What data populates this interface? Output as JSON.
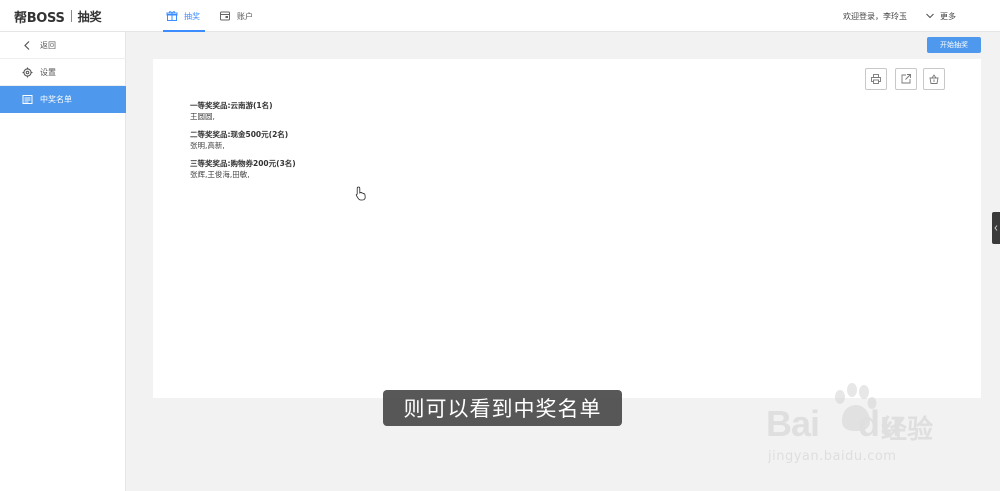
{
  "header": {
    "brand": "帮BOSS",
    "module": "抽奖",
    "tabs": [
      {
        "label": "抽奖",
        "icon": "gift-icon",
        "active": true
      },
      {
        "label": "账户",
        "icon": "account-icon",
        "active": false
      }
    ],
    "welcome": "欢迎登录，李玲玉",
    "more_label": "更多"
  },
  "sidebar": {
    "items": [
      {
        "label": "返回",
        "icon": "chevron-left-icon"
      },
      {
        "label": "设置",
        "icon": "gear-icon"
      },
      {
        "label": "中奖名单",
        "icon": "list-icon",
        "active": true
      }
    ]
  },
  "main": {
    "start_button": "开始抽奖",
    "toolbar": [
      "print-icon",
      "export-icon",
      "clear-icon"
    ],
    "prizes": [
      {
        "title": "一等奖奖品:云南游(1名)",
        "winners": "王圆圆,"
      },
      {
        "title": "二等奖奖品:现金500元(2名)",
        "winners": "张明,高新,"
      },
      {
        "title": "三等奖奖品:购物券200元(3名)",
        "winners": "张辉,王俊海,田敏,"
      }
    ]
  },
  "caption": "则可以看到中奖名单",
  "watermark": {
    "main": "Bai",
    "main2": "du",
    "cn": "经验",
    "url": "jingyan.baidu.com"
  },
  "colors": {
    "accent": "#4e99ee",
    "tab_active": "#3c8dff"
  }
}
